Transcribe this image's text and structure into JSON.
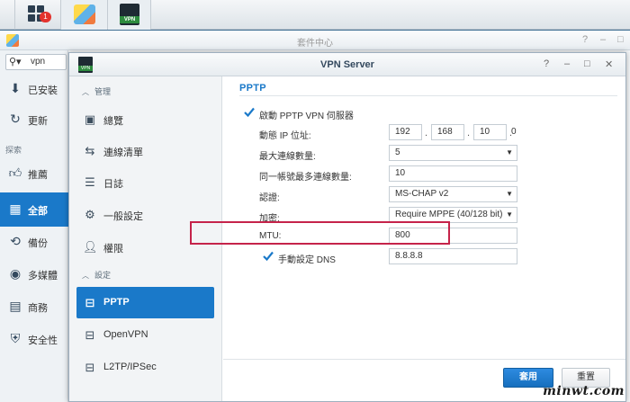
{
  "taskbar": {
    "notification_count": "1",
    "vpn_badge": "VPN"
  },
  "package_center": {
    "title": "套件中心",
    "search_value": "vpn",
    "items": [
      {
        "label": "已安裝",
        "icon": "download-icon"
      },
      {
        "label": "更新",
        "icon": "refresh-icon"
      }
    ],
    "section_explore": "探索",
    "categories": [
      {
        "label": "推薦",
        "icon": "thumbs-up-icon"
      },
      {
        "label": "全部",
        "icon": "grid-icon",
        "active": true
      },
      {
        "label": "備份",
        "icon": "backup-icon"
      },
      {
        "label": "多媒體",
        "icon": "media-icon"
      },
      {
        "label": "商務",
        "icon": "briefcase-icon"
      },
      {
        "label": "安全性",
        "icon": "shield-icon"
      }
    ]
  },
  "vpn_window": {
    "title": "VPN Server",
    "app_badge": "VPN",
    "sidebar": {
      "section_manage": "管理",
      "manage_items": [
        {
          "label": "總覽",
          "icon": "overview-icon"
        },
        {
          "label": "連線清單",
          "icon": "connection-list-icon"
        },
        {
          "label": "日誌",
          "icon": "log-icon"
        },
        {
          "label": "一般設定",
          "icon": "gear-icon"
        },
        {
          "label": "權限",
          "icon": "user-icon"
        }
      ],
      "section_settings": "設定",
      "settings_items": [
        {
          "label": "PPTP",
          "icon": "network-icon",
          "active": true
        },
        {
          "label": "OpenVPN",
          "icon": "network-icon"
        },
        {
          "label": "L2TP/IPSec",
          "icon": "network-icon"
        }
      ]
    },
    "content": {
      "heading": "PPTP",
      "enable_label": "啟動 PPTP VPN 伺服器",
      "enable_checked": true,
      "dynamic_ip_label": "動態 IP 位址:",
      "ip": [
        "192",
        "168",
        "10",
        "0"
      ],
      "max_conn_label": "最大連線數量:",
      "max_conn_value": "5",
      "same_account_label": "同一帳號最多連線數量:",
      "same_account_value": "10",
      "auth_label": "認證:",
      "auth_value": "MS-CHAP v2",
      "encryption_label": "加密:",
      "encryption_value": "Require MPPE (40/128 bit)",
      "mtu_label": "MTU:",
      "mtu_value": "800",
      "manual_dns_label": "手動設定 DNS",
      "manual_dns_checked": true,
      "dns_value": "8.8.8.8"
    },
    "footer": {
      "apply_label": "套用",
      "reset_label": "重置"
    }
  },
  "watermark": "minwt.com",
  "colors": {
    "accent": "#1a79c9",
    "highlight_border": "#c5234a"
  }
}
